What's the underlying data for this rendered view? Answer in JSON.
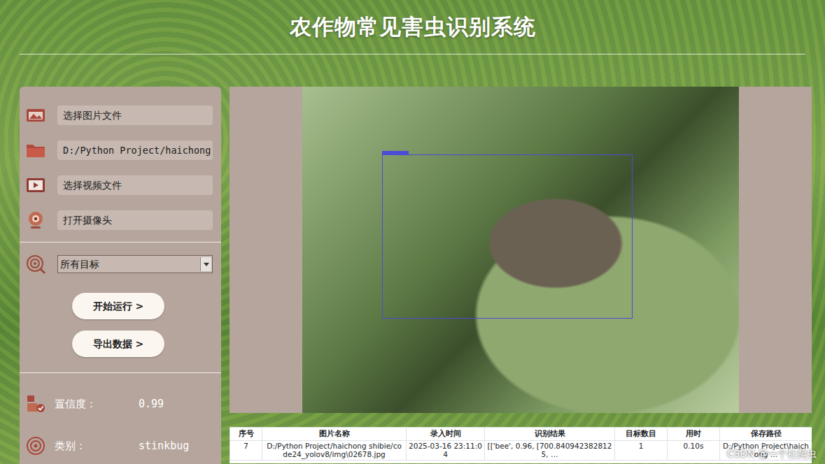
{
  "title": "农作物常见害虫识别系统",
  "sidebar": {
    "items": [
      {
        "label": "选择图片文件"
      },
      {
        "label": "D:/Python Project/haichong"
      },
      {
        "label": "选择视频文件"
      },
      {
        "label": "打开摄像头"
      }
    ]
  },
  "dropdown": {
    "value": "所有目标"
  },
  "buttons": [
    "开始运行 >",
    "导出数据 >"
  ],
  "stats": [
    {
      "label": "置信度：",
      "value": "0.99"
    },
    {
      "label": "类别：",
      "value": "stinkbug"
    }
  ],
  "table": {
    "columns": [
      "序号",
      "图片名称",
      "录入时间",
      "识别结果",
      "目标数目",
      "用时",
      "保存路径"
    ],
    "rows": [
      [
        "7",
        "D:/Python Project/haichong shibie/code24_yolov8/img\\02678.jpg",
        "2025-03-16 23:11:04",
        "[['bee', 0.96, [700.8409423828125, …",
        "1",
        "0.10s",
        "D:/Python Project\\haichong …"
      ]
    ]
  },
  "watermark": "CSDN @一个社爬虫"
}
